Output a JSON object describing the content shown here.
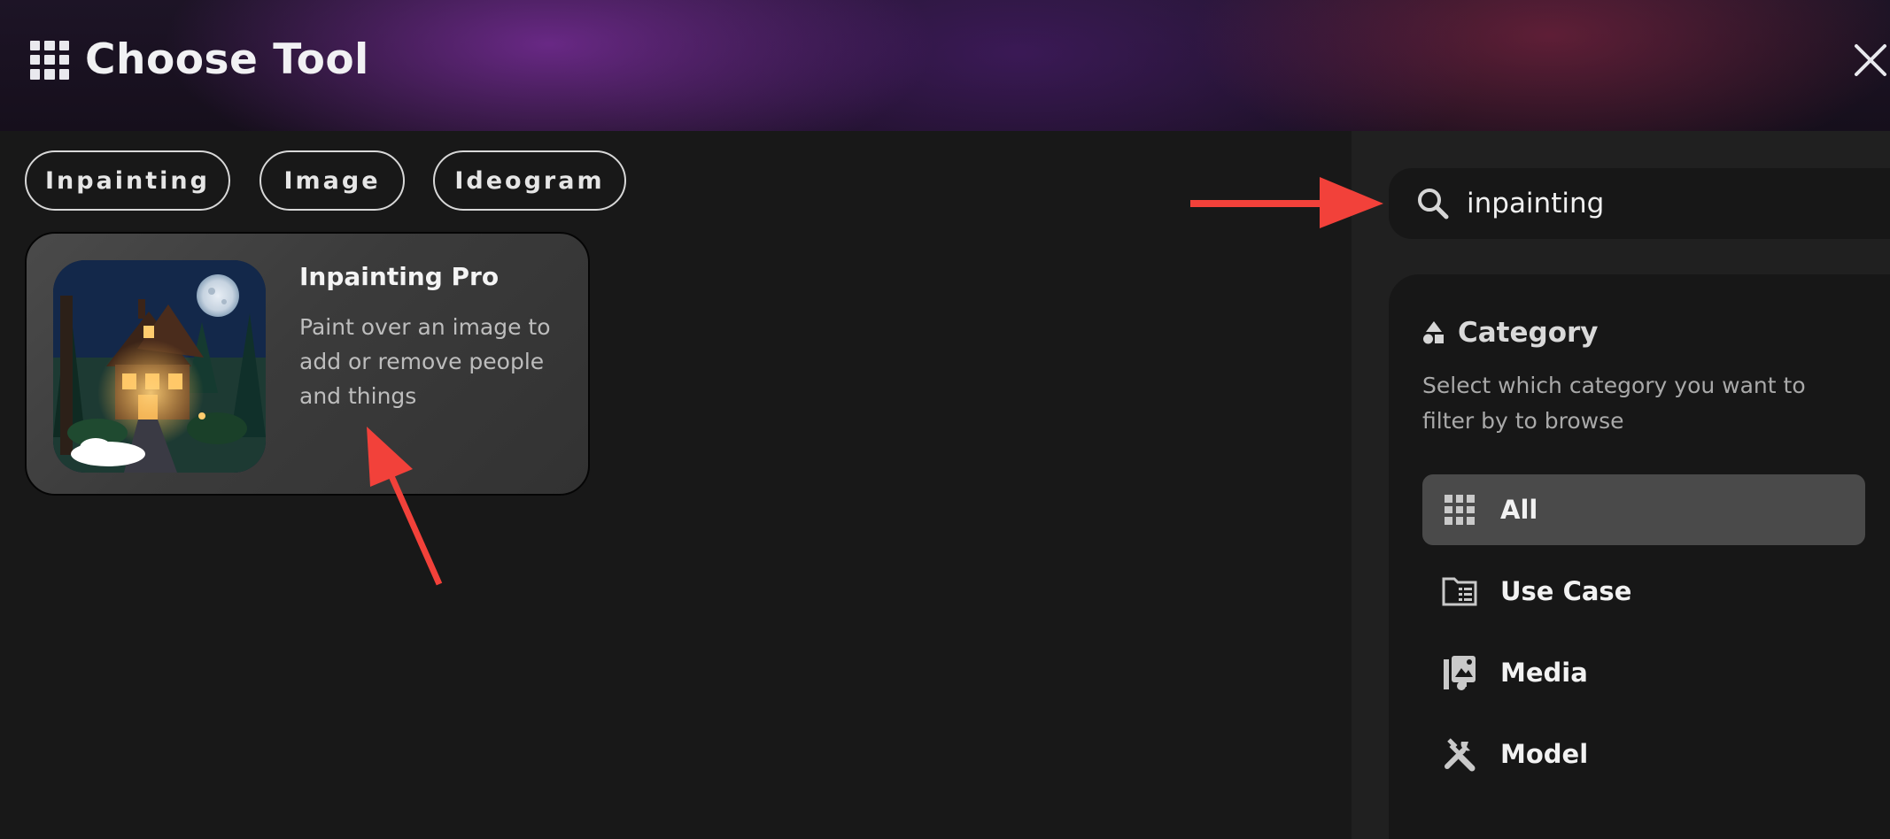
{
  "header": {
    "title": "Choose Tool",
    "icon": "grid-icon",
    "close_icon": "close-icon"
  },
  "filters": {
    "chips": [
      {
        "label": "Inpainting"
      },
      {
        "label": "Image"
      },
      {
        "label": "Ideogram"
      }
    ]
  },
  "results": {
    "tools": [
      {
        "name": "Inpainting Pro",
        "description": "Paint over an image to add or remove people and things",
        "thumbnail": "night-cottage-illustration"
      }
    ]
  },
  "search": {
    "value": "inpainting",
    "icon": "search-icon"
  },
  "category": {
    "title": "Category",
    "icon": "shapes-icon",
    "description": "Select which category you want to filter by to browse",
    "items": [
      {
        "label": "All",
        "icon": "grid-icon",
        "active": true
      },
      {
        "label": "Use Case",
        "icon": "folder-list-icon",
        "active": false
      },
      {
        "label": "Media",
        "icon": "media-library-icon",
        "active": false
      },
      {
        "label": "Model",
        "icon": "tools-icon",
        "active": false
      }
    ]
  },
  "annotations": {
    "arrow_color": "#f2413a"
  },
  "colors": {
    "background": "#181818",
    "panel": "#202020",
    "active_item": "#4a4a4a",
    "accent_purple": "#762c96"
  }
}
